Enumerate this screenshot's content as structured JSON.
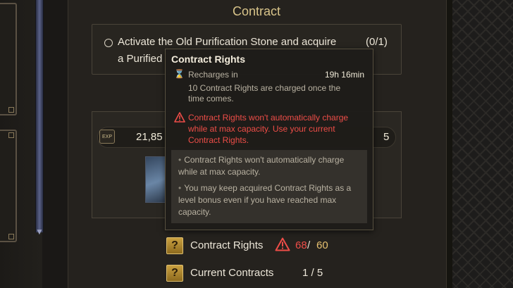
{
  "header": {
    "title": "Contract"
  },
  "quest": {
    "line1": "Activate the Old Purification Stone and acquire",
    "line2": "a Purified",
    "progress": "(0/1)"
  },
  "reward": {
    "exp_label": "EXP",
    "exp_value": "21,85",
    "right_value": "5"
  },
  "tooltip": {
    "title": "Contract Rights",
    "recharge_label": "Recharges in",
    "recharge_time": "19h 16min",
    "recharge_note": "10 Contract Rights are charged once the time comes.",
    "warning": "Contract Rights won't automatically charge while at max capacity. Use your current Contract Rights.",
    "bullets": [
      "Contract Rights won't automatically charge while at max capacity.",
      "You may keep acquired Contract Rights as a level bonus even if you have reached max capacity."
    ],
    "warning_color": "#ee4d48"
  },
  "stats": {
    "contract_rights": {
      "label": "Contract Rights",
      "current": "68",
      "separator": "/",
      "max": "60"
    },
    "current_contracts": {
      "label": "Current Contracts",
      "value": "1 / 5"
    },
    "help_icon_glyph": "?"
  }
}
